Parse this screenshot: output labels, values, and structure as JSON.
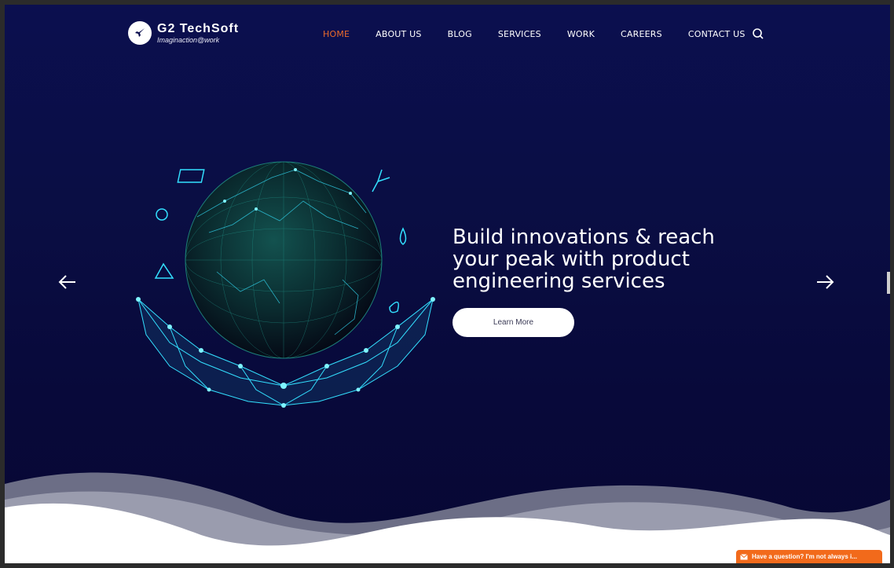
{
  "logo": {
    "name": "G2 TechSoft",
    "tagline": "Imaginaction@work"
  },
  "nav": [
    {
      "label": "HOME",
      "active": true
    },
    {
      "label": "ABOUT US",
      "active": false
    },
    {
      "label": "BLOG",
      "active": false
    },
    {
      "label": "SERVICES",
      "active": false
    },
    {
      "label": "WORK",
      "active": false
    },
    {
      "label": "CAREERS",
      "active": false
    },
    {
      "label": "CONTACT US",
      "active": false
    }
  ],
  "icons": {
    "search": "search-icon",
    "prev": "arrow-left-icon",
    "next": "arrow-right-icon",
    "chat": "mail-icon"
  },
  "hero": {
    "headline": "Build innovations & reach your peak with product engineering services",
    "cta": "Learn More"
  },
  "chat": {
    "text": "Have a question? I'm not always i..."
  },
  "colors": {
    "accent": "#ea6a2b",
    "background": "#0b0f4f",
    "glow": "#33e0ff",
    "chat": "#f26a1b"
  }
}
